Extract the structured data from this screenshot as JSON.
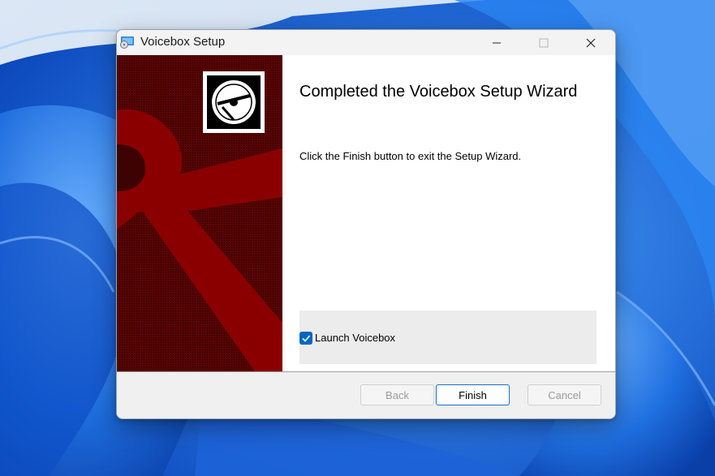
{
  "window": {
    "title": "Voicebox Setup",
    "controls": {
      "minimize": "minimize",
      "maximize": "maximize",
      "close": "close"
    }
  },
  "wizard": {
    "heading": "Completed the Voicebox Setup Wizard",
    "description": "Click the Finish button to exit the Setup Wizard.",
    "launch_checkbox": {
      "label": "Launch Voicebox",
      "checked": true
    }
  },
  "buttons": {
    "back": "Back",
    "finish": "Finish",
    "cancel": "Cancel"
  },
  "icons": {
    "app": "installer-disc-icon",
    "banner_logo": "disc-icon",
    "banner_art": "anchor-icon"
  },
  "colors": {
    "banner": "#5a0505",
    "accent": "#0067c0",
    "wallpaper": "#3d7fe6"
  }
}
